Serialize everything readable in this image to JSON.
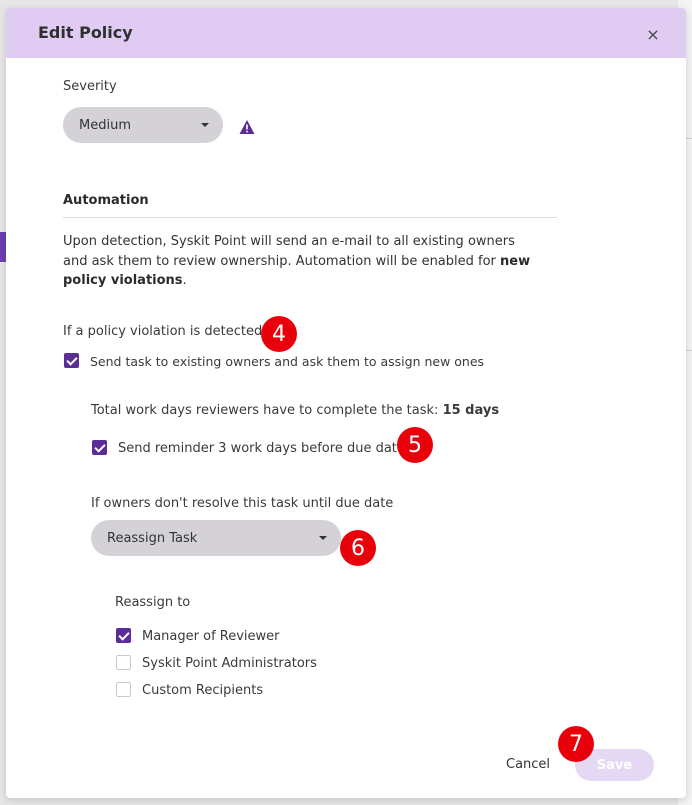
{
  "modal": {
    "title": "Edit Policy",
    "close_label": "×"
  },
  "severity": {
    "label": "Severity",
    "value": "Medium"
  },
  "automation": {
    "heading": "Automation",
    "description_start": "Upon detection, Syskit Point will send an e-mail to all existing owners and ask them to review ownership. Automation will be enabled for ",
    "description_bold": "new policy violations",
    "description_end": ".",
    "detect_label": "If a policy violation is detected",
    "send_task_label": "Send task to existing owners and ask them to assign new ones",
    "send_task_checked": true,
    "work_days_label": "Total work days reviewers have to complete the task: ",
    "work_days_value": "15 days",
    "reminder_label": "Send reminder 3 work days before due date",
    "reminder_checked": true,
    "unresolved_label": "If owners don't resolve this task until due date",
    "unresolved_action": "Reassign Task",
    "reassign_to_label": "Reassign to",
    "reassign_options": [
      {
        "label": "Manager of Reviewer",
        "checked": true
      },
      {
        "label": "Syskit Point Administrators",
        "checked": false
      },
      {
        "label": "Custom Recipients",
        "checked": false
      }
    ]
  },
  "footer": {
    "cancel_label": "Cancel",
    "save_label": "Save"
  },
  "markers": [
    "4",
    "5",
    "6",
    "7"
  ],
  "colors": {
    "header_bg": "#e0ccf2",
    "accent": "#5b2d96",
    "warning": "#5b2d96",
    "marker": "#e8000b",
    "save_disabled": "#e5d8f4"
  },
  "icons": {
    "close": "close-icon",
    "warning": "warning-triangle-icon",
    "dropdown": "chevron-down-icon",
    "checkbox": "checkbox-icon"
  }
}
